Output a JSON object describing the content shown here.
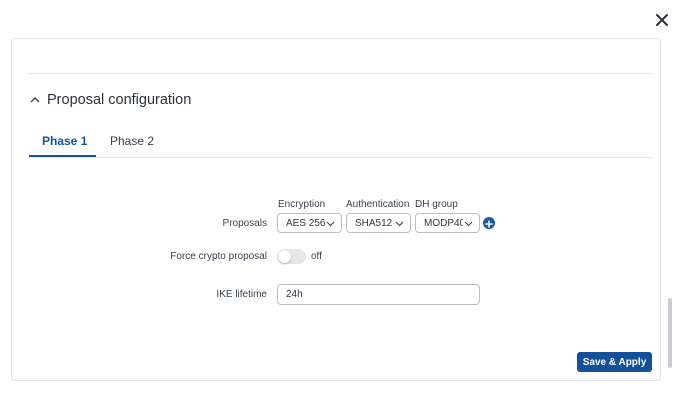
{
  "section": {
    "title": "Proposal configuration",
    "expanded": true
  },
  "tabs": [
    {
      "label": "Phase 1",
      "active": true
    },
    {
      "label": "Phase 2",
      "active": false
    }
  ],
  "proposals": {
    "label": "Proposals",
    "columns": {
      "encryption": "Encryption",
      "authentication": "Authentication",
      "dh_group": "DH group"
    },
    "encryption_value": "AES 256",
    "authentication_value": "SHA512",
    "dh_group_value": "MODP40..."
  },
  "force_crypto": {
    "label": "Force crypto proposal",
    "state_text": "off"
  },
  "ike_lifetime": {
    "label": "IKE lifetime",
    "value": "24h"
  },
  "save_button": {
    "label": "Save & Apply"
  },
  "colors": {
    "accent": "#14519b",
    "plus": "#1c5aa6",
    "toggle_off": "#e4e6ea"
  },
  "icons": [
    "close-icon",
    "chevron-up-icon",
    "chevron-down-icon",
    "plus-icon"
  ]
}
